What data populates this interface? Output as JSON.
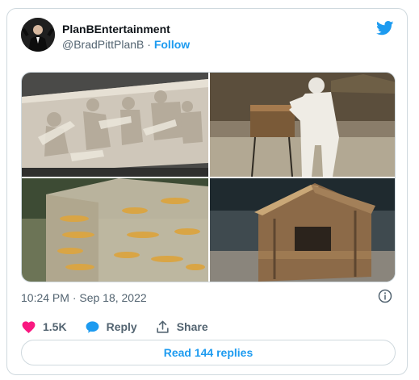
{
  "author": {
    "display_name": "PlanBEntertainment",
    "handle": "@BradPittPlanB",
    "separator": " · ",
    "follow_label": "Follow"
  },
  "brand_icon": "twitter-bird-icon",
  "media": [
    {
      "description": "sculpted-relief-panel"
    },
    {
      "description": "figure-in-white-at-wooden-box"
    },
    {
      "description": "translucent-resin-house"
    },
    {
      "description": "wooden-house-sculpture"
    }
  ],
  "timestamp": "10:24 PM · Sep 18, 2022",
  "actions": {
    "like_count": "1.5K",
    "reply_label": "Reply",
    "share_label": "Share"
  },
  "read_replies_label": "Read 144 replies",
  "colors": {
    "accent": "#1d9bf0",
    "like": "#f91880",
    "text_secondary": "#536471",
    "border": "#cfd9de"
  }
}
